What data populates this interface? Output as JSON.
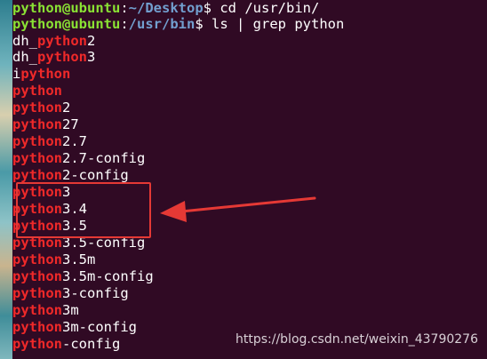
{
  "prompt1": {
    "user_host": "python@ubuntu",
    "colon": ":",
    "path": "~/Desktop",
    "dollar": "$ ",
    "command": "cd /usr/bin/"
  },
  "prompt2": {
    "user_host": "python@ubuntu",
    "colon": ":",
    "path": "/usr/bin",
    "dollar": "$ ",
    "command": "ls | grep python"
  },
  "output": [
    {
      "pre": "dh_",
      "match": "python",
      "post": "2"
    },
    {
      "pre": "dh_",
      "match": "python",
      "post": "3"
    },
    {
      "pre": "i",
      "match": "python",
      "post": ""
    },
    {
      "pre": "",
      "match": "python",
      "post": ""
    },
    {
      "pre": "",
      "match": "python",
      "post": "2"
    },
    {
      "pre": "",
      "match": "python",
      "post": "27"
    },
    {
      "pre": "",
      "match": "python",
      "post": "2.7"
    },
    {
      "pre": "",
      "match": "python",
      "post": "2.7-config"
    },
    {
      "pre": "",
      "match": "python",
      "post": "2-config"
    },
    {
      "pre": "",
      "match": "python",
      "post": "3"
    },
    {
      "pre": "",
      "match": "python",
      "post": "3.4"
    },
    {
      "pre": "",
      "match": "python",
      "post": "3.5"
    },
    {
      "pre": "",
      "match": "python",
      "post": "3.5-config"
    },
    {
      "pre": "",
      "match": "python",
      "post": "3.5m"
    },
    {
      "pre": "",
      "match": "python",
      "post": "3.5m-config"
    },
    {
      "pre": "",
      "match": "python",
      "post": "3-config"
    },
    {
      "pre": "",
      "match": "python",
      "post": "3m"
    },
    {
      "pre": "",
      "match": "python",
      "post": "3m-config"
    },
    {
      "pre": "",
      "match": "python",
      "post": "-config"
    }
  ],
  "colors": {
    "background": "#300a24",
    "prompt_user": "#8ae234",
    "prompt_path": "#729fcf",
    "match": "#ef2929",
    "annotation": "#e53935"
  },
  "watermark": "https://blog.csdn.net/weixin_43790276"
}
